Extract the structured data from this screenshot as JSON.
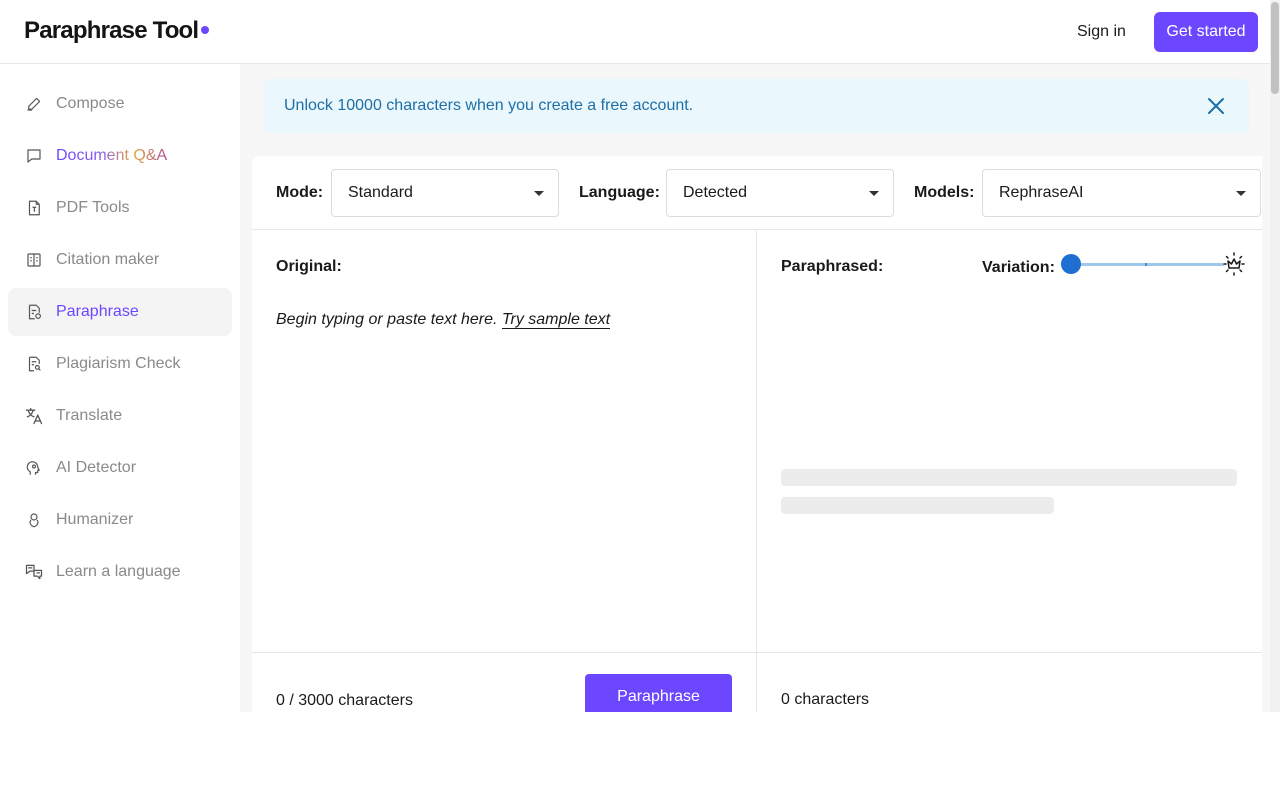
{
  "header": {
    "logo": "Paraphrase Tool",
    "sign_in": "Sign in",
    "get_started": "Get started"
  },
  "sidebar": {
    "items": [
      {
        "label": "Compose",
        "icon": "pencil-icon"
      },
      {
        "label": "Document Q&A",
        "icon": "chat-bubble-icon"
      },
      {
        "label": "PDF Tools",
        "icon": "pdf-file-icon"
      },
      {
        "label": "Citation maker",
        "icon": "book-icon"
      },
      {
        "label": "Paraphrase",
        "icon": "paraphrase-doc-icon",
        "active": true
      },
      {
        "label": "Plagiarism Check",
        "icon": "doc-search-icon"
      },
      {
        "label": "Translate",
        "icon": "translate-icon"
      },
      {
        "label": "AI Detector",
        "icon": "head-gear-icon"
      },
      {
        "label": "Humanizer",
        "icon": "humanizer-icon"
      },
      {
        "label": "Learn a language",
        "icon": "language-chat-icon"
      }
    ]
  },
  "banner": {
    "text": "Unlock 10000 characters when you create a free account."
  },
  "toolbar": {
    "mode_label": "Mode:",
    "mode_value": "Standard",
    "language_label": "Language:",
    "language_value": "Detected",
    "models_label": "Models:",
    "models_value": "RephraseAI"
  },
  "original": {
    "title": "Original:",
    "placeholder": "Begin typing or paste text here.",
    "sample_link": "Try sample text",
    "char_count": "0 / 3000 characters",
    "button": "Paraphrase"
  },
  "paraphrased": {
    "title": "Paraphrased:",
    "variation_label": "Variation:",
    "variation_level": 0,
    "char_count": "0 characters"
  },
  "colors": {
    "accent": "#6c47ff",
    "banner_bg": "#eaf7fc",
    "banner_text": "#1f6fa6",
    "slider": "#1e6fd1"
  }
}
